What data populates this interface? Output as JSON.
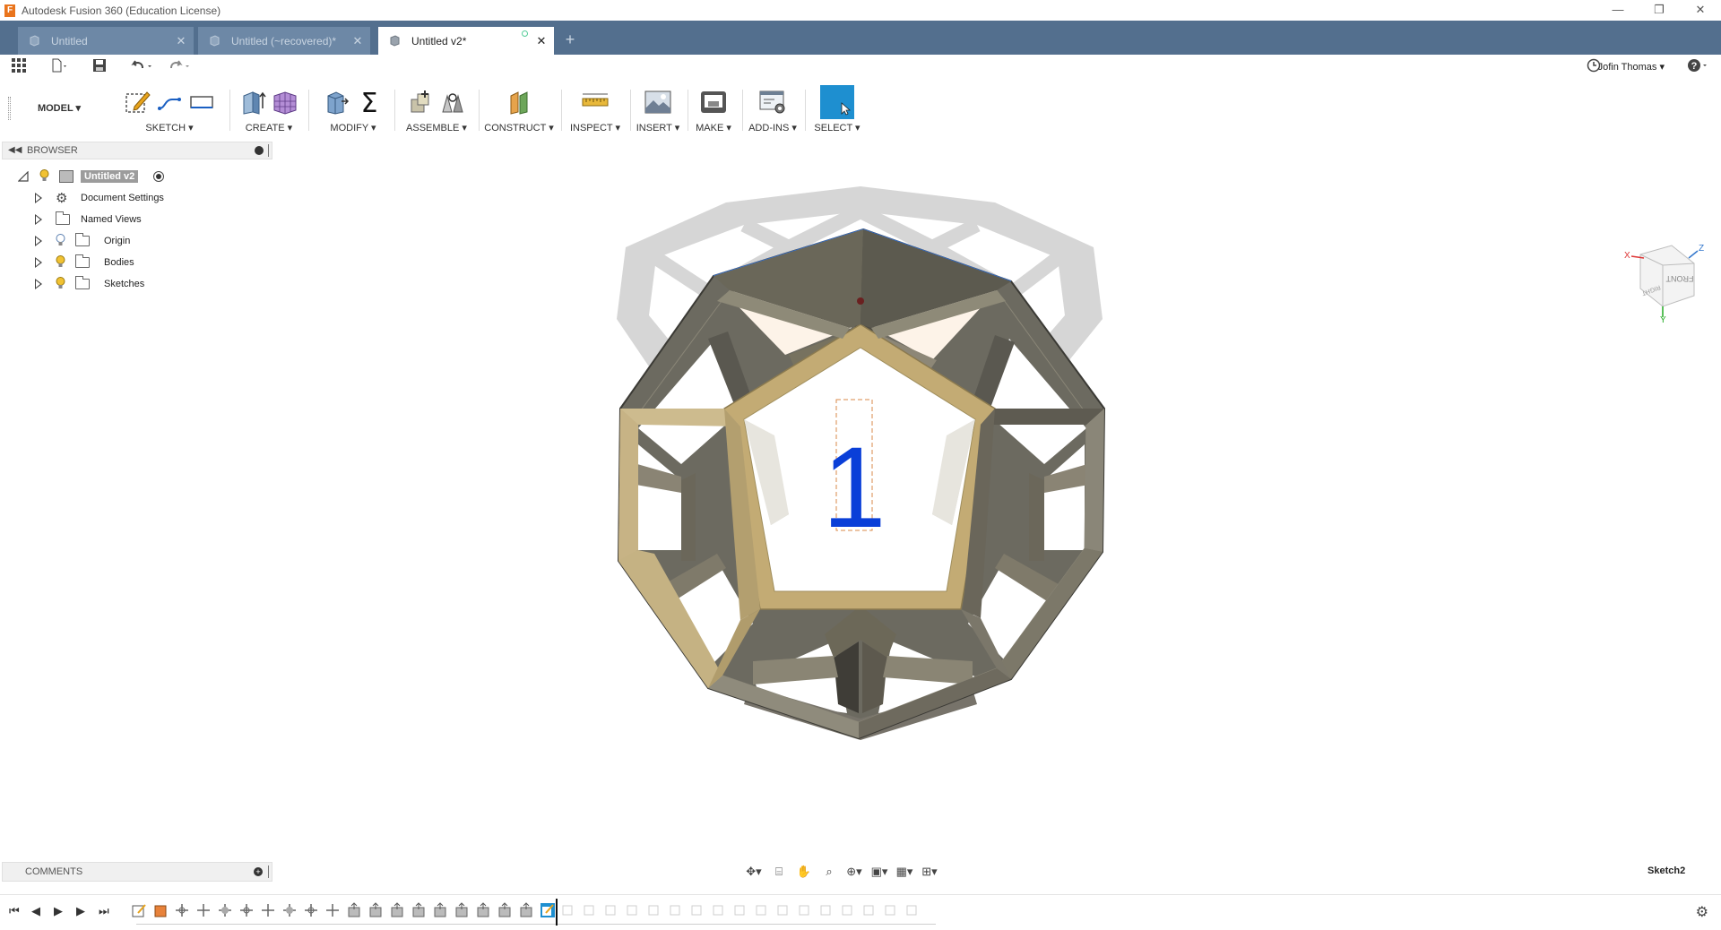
{
  "window": {
    "title": "Autodesk Fusion 360 (Education License)",
    "logo_letter": "F",
    "controls": [
      "—",
      "❐",
      "✕"
    ]
  },
  "tabs": [
    {
      "label": "Untitled",
      "active": false
    },
    {
      "label": "Untitled (~recovered)*",
      "active": false
    },
    {
      "label": "Untitled v2*",
      "active": true
    }
  ],
  "quick_access": {
    "user_name": "Jofin Thomas",
    "user_caret": "▾"
  },
  "ribbon": {
    "workspace": "MODEL",
    "groups": [
      {
        "id": "sketch",
        "label": "SKETCH ▾"
      },
      {
        "id": "create",
        "label": "CREATE ▾"
      },
      {
        "id": "modify",
        "label": "MODIFY ▾"
      },
      {
        "id": "assemble",
        "label": "ASSEMBLE ▾"
      },
      {
        "id": "construct",
        "label": "CONSTRUCT ▾"
      },
      {
        "id": "inspect",
        "label": "INSPECT ▾"
      },
      {
        "id": "insert",
        "label": "INSERT ▾"
      },
      {
        "id": "make",
        "label": "MAKE ▾"
      },
      {
        "id": "addins",
        "label": "ADD-INS ▾"
      },
      {
        "id": "select",
        "label": "SELECT ▾"
      }
    ]
  },
  "browser": {
    "title": "BROWSER",
    "root": "Untitled v2",
    "items": [
      {
        "label": "Document Settings"
      },
      {
        "label": "Named Views"
      },
      {
        "label": "Origin"
      },
      {
        "label": "Bodies"
      },
      {
        "label": "Sketches"
      }
    ]
  },
  "viewport": {
    "sketch_text": "1",
    "viewcube_faces": [
      "FRONT",
      "RIGHT"
    ],
    "axis_labels": {
      "x": "X",
      "z": "Z",
      "y": "Y"
    }
  },
  "comments": {
    "title": "COMMENTS"
  },
  "status": {
    "active_sketch": "Sketch2"
  },
  "colors": {
    "tab_bar": "#536f8e",
    "selected_face": "#c3ab74",
    "body": "#7d7868",
    "sketch_text": "#0a3fd8",
    "select_button": "#1e8fd0"
  }
}
